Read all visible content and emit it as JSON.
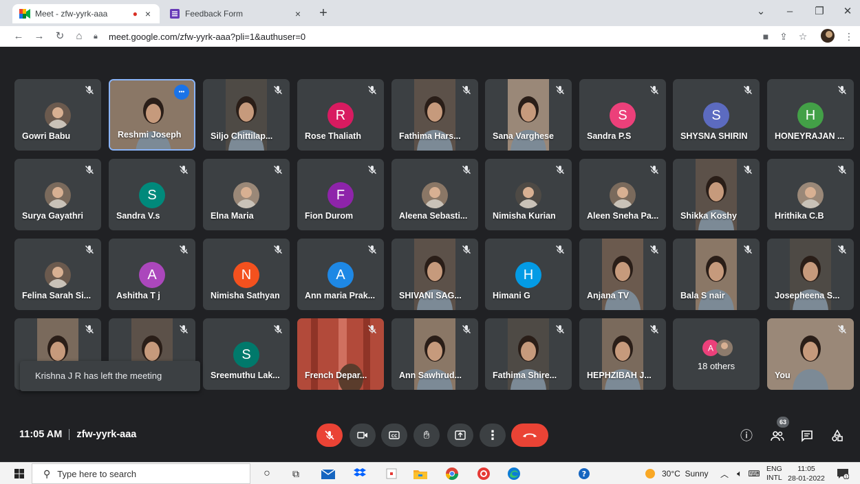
{
  "browser": {
    "tabs": [
      {
        "title": "Meet - zfw-yyrk-aaa",
        "recording": "●",
        "close": "×"
      },
      {
        "title": "Feedback Form",
        "close": "×"
      }
    ],
    "new_tab": "+",
    "url": "meet.google.com/zfw-yyrk-aaa?pli=1&authuser=0"
  },
  "participants": [
    {
      "name": "Gowri Babu",
      "kind": "photo"
    },
    {
      "name": "Reshmi Joseph",
      "kind": "video",
      "speaking": true
    },
    {
      "name": "Siljo Chittilap...",
      "kind": "video"
    },
    {
      "name": "Rose Thaliath",
      "kind": "letter",
      "letter": "R",
      "color": "#d81b60"
    },
    {
      "name": "Fathima Hars...",
      "kind": "video"
    },
    {
      "name": "Sana Varghese",
      "kind": "video"
    },
    {
      "name": "Sandra P.S",
      "kind": "letter",
      "letter": "S",
      "color": "#ec407a"
    },
    {
      "name": "SHYSNA SHIRIN",
      "kind": "letter",
      "letter": "S",
      "color": "#5c6bc0"
    },
    {
      "name": "HONEYRAJAN ...",
      "kind": "letter",
      "letter": "H",
      "color": "#43a047"
    },
    {
      "name": "Surya Gayathri",
      "kind": "photo"
    },
    {
      "name": "Sandra V.s",
      "kind": "letter",
      "letter": "S",
      "color": "#00897b"
    },
    {
      "name": "Elna Maria",
      "kind": "photo"
    },
    {
      "name": "Fion Durom",
      "kind": "letter",
      "letter": "F",
      "color": "#8e24aa"
    },
    {
      "name": "Aleena Sebasti...",
      "kind": "photo"
    },
    {
      "name": "Nimisha Kurian",
      "kind": "photo"
    },
    {
      "name": "Aleen Sneha Pa...",
      "kind": "photo"
    },
    {
      "name": "Shikka Koshy",
      "kind": "video"
    },
    {
      "name": "Hrithika C.B",
      "kind": "photo"
    },
    {
      "name": "Felina Sarah Si...",
      "kind": "photo"
    },
    {
      "name": "Ashitha T j",
      "kind": "letter",
      "letter": "A",
      "color": "#ab47bc"
    },
    {
      "name": "Nimisha Sathyan",
      "kind": "letter",
      "letter": "N",
      "color": "#f4511e"
    },
    {
      "name": "Ann maria Prak...",
      "kind": "letter",
      "letter": "A",
      "color": "#1e88e5"
    },
    {
      "name": "SHIVANI SAG...",
      "kind": "video"
    },
    {
      "name": "Himani G",
      "kind": "letter",
      "letter": "H",
      "color": "#039be5"
    },
    {
      "name": "Anjana TV",
      "kind": "video"
    },
    {
      "name": "Bala S nair",
      "kind": "video"
    },
    {
      "name": "Josepheena S...",
      "kind": "video"
    },
    {
      "name": "",
      "kind": "video"
    },
    {
      "name": "",
      "kind": "video"
    },
    {
      "name": "Sreemuthu Lak...",
      "kind": "letter",
      "letter": "S",
      "color": "#00796b"
    },
    {
      "name": "French Depar...",
      "kind": "video"
    },
    {
      "name": "Ann Sawhrud...",
      "kind": "video"
    },
    {
      "name": "Fathima Shire...",
      "kind": "video"
    },
    {
      "name": "HEPHZIBAH J...",
      "kind": "video"
    },
    {
      "name": "",
      "kind": "others",
      "letter": "A"
    },
    {
      "name": "You",
      "kind": "video"
    }
  ],
  "others_label": "18 others",
  "toast": "Krishna J R has left the meeting",
  "meeting": {
    "time": "11:05 AM",
    "code": "zfw-yyrk-aaa"
  },
  "people_count": "63",
  "taskbar": {
    "search_placeholder": "Type here to search",
    "weather": "30°C  Sunny",
    "lang": "ENG",
    "lang2": "INTL",
    "time": "11:05",
    "date": "28-01-2022"
  }
}
